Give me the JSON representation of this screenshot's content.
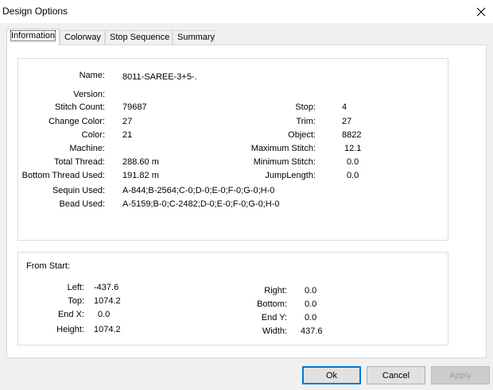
{
  "window": {
    "title": "Design Options"
  },
  "tabs": [
    "Information",
    "Colorway",
    "Stop Sequence",
    "Summary"
  ],
  "info": {
    "left": [
      {
        "label": "Name:",
        "value": "8011-SAREE-3+5-."
      },
      {
        "label": "Version:",
        "value": ""
      },
      {
        "label": "Stitch Count:",
        "value": "79687"
      },
      {
        "label": "Change Color:",
        "value": "27"
      },
      {
        "label": "Color:",
        "value": "21"
      },
      {
        "label": "Machine:",
        "value": ""
      },
      {
        "label": "Total Thread:",
        "value": "288.60 m"
      },
      {
        "label": "Bottom Thread Used:",
        "value": "191.82 m"
      },
      {
        "label": "Sequin Used:",
        "value": "A-844;B-2564;C-0;D-0;E-0;F-0;G-0;H-0"
      },
      {
        "label": "Bead Used:",
        "value": "A-5159;B-0;C-2482;D-0;E-0;F-0;G-0;H-0"
      }
    ],
    "right": [
      {
        "label": "Stop:",
        "value": "4"
      },
      {
        "label": "Trim:",
        "value": "27"
      },
      {
        "label": "Object:",
        "value": "8822"
      },
      {
        "label": "Maximum Stitch:",
        "value": "12.1"
      },
      {
        "label": "Minimum Stitch:",
        "value": "0.0"
      },
      {
        "label": "JumpLength:",
        "value": "0.0"
      }
    ]
  },
  "from_start": {
    "title": "From Start:",
    "left": [
      {
        "label": "Left:",
        "value": "-437.6"
      },
      {
        "label": "Top:",
        "value": "1074.2"
      },
      {
        "label": "End X:",
        "value": "0.0"
      },
      {
        "label": "Height:",
        "value": "1074.2"
      }
    ],
    "right": [
      {
        "label": "Right:",
        "value": "0.0"
      },
      {
        "label": "Bottom:",
        "value": "0.0"
      },
      {
        "label": "End Y:",
        "value": "0.0"
      },
      {
        "label": "Width:",
        "value": "437.6"
      }
    ]
  },
  "buttons": {
    "ok": "Ok",
    "cancel": "Cancel",
    "apply": "Apply"
  }
}
